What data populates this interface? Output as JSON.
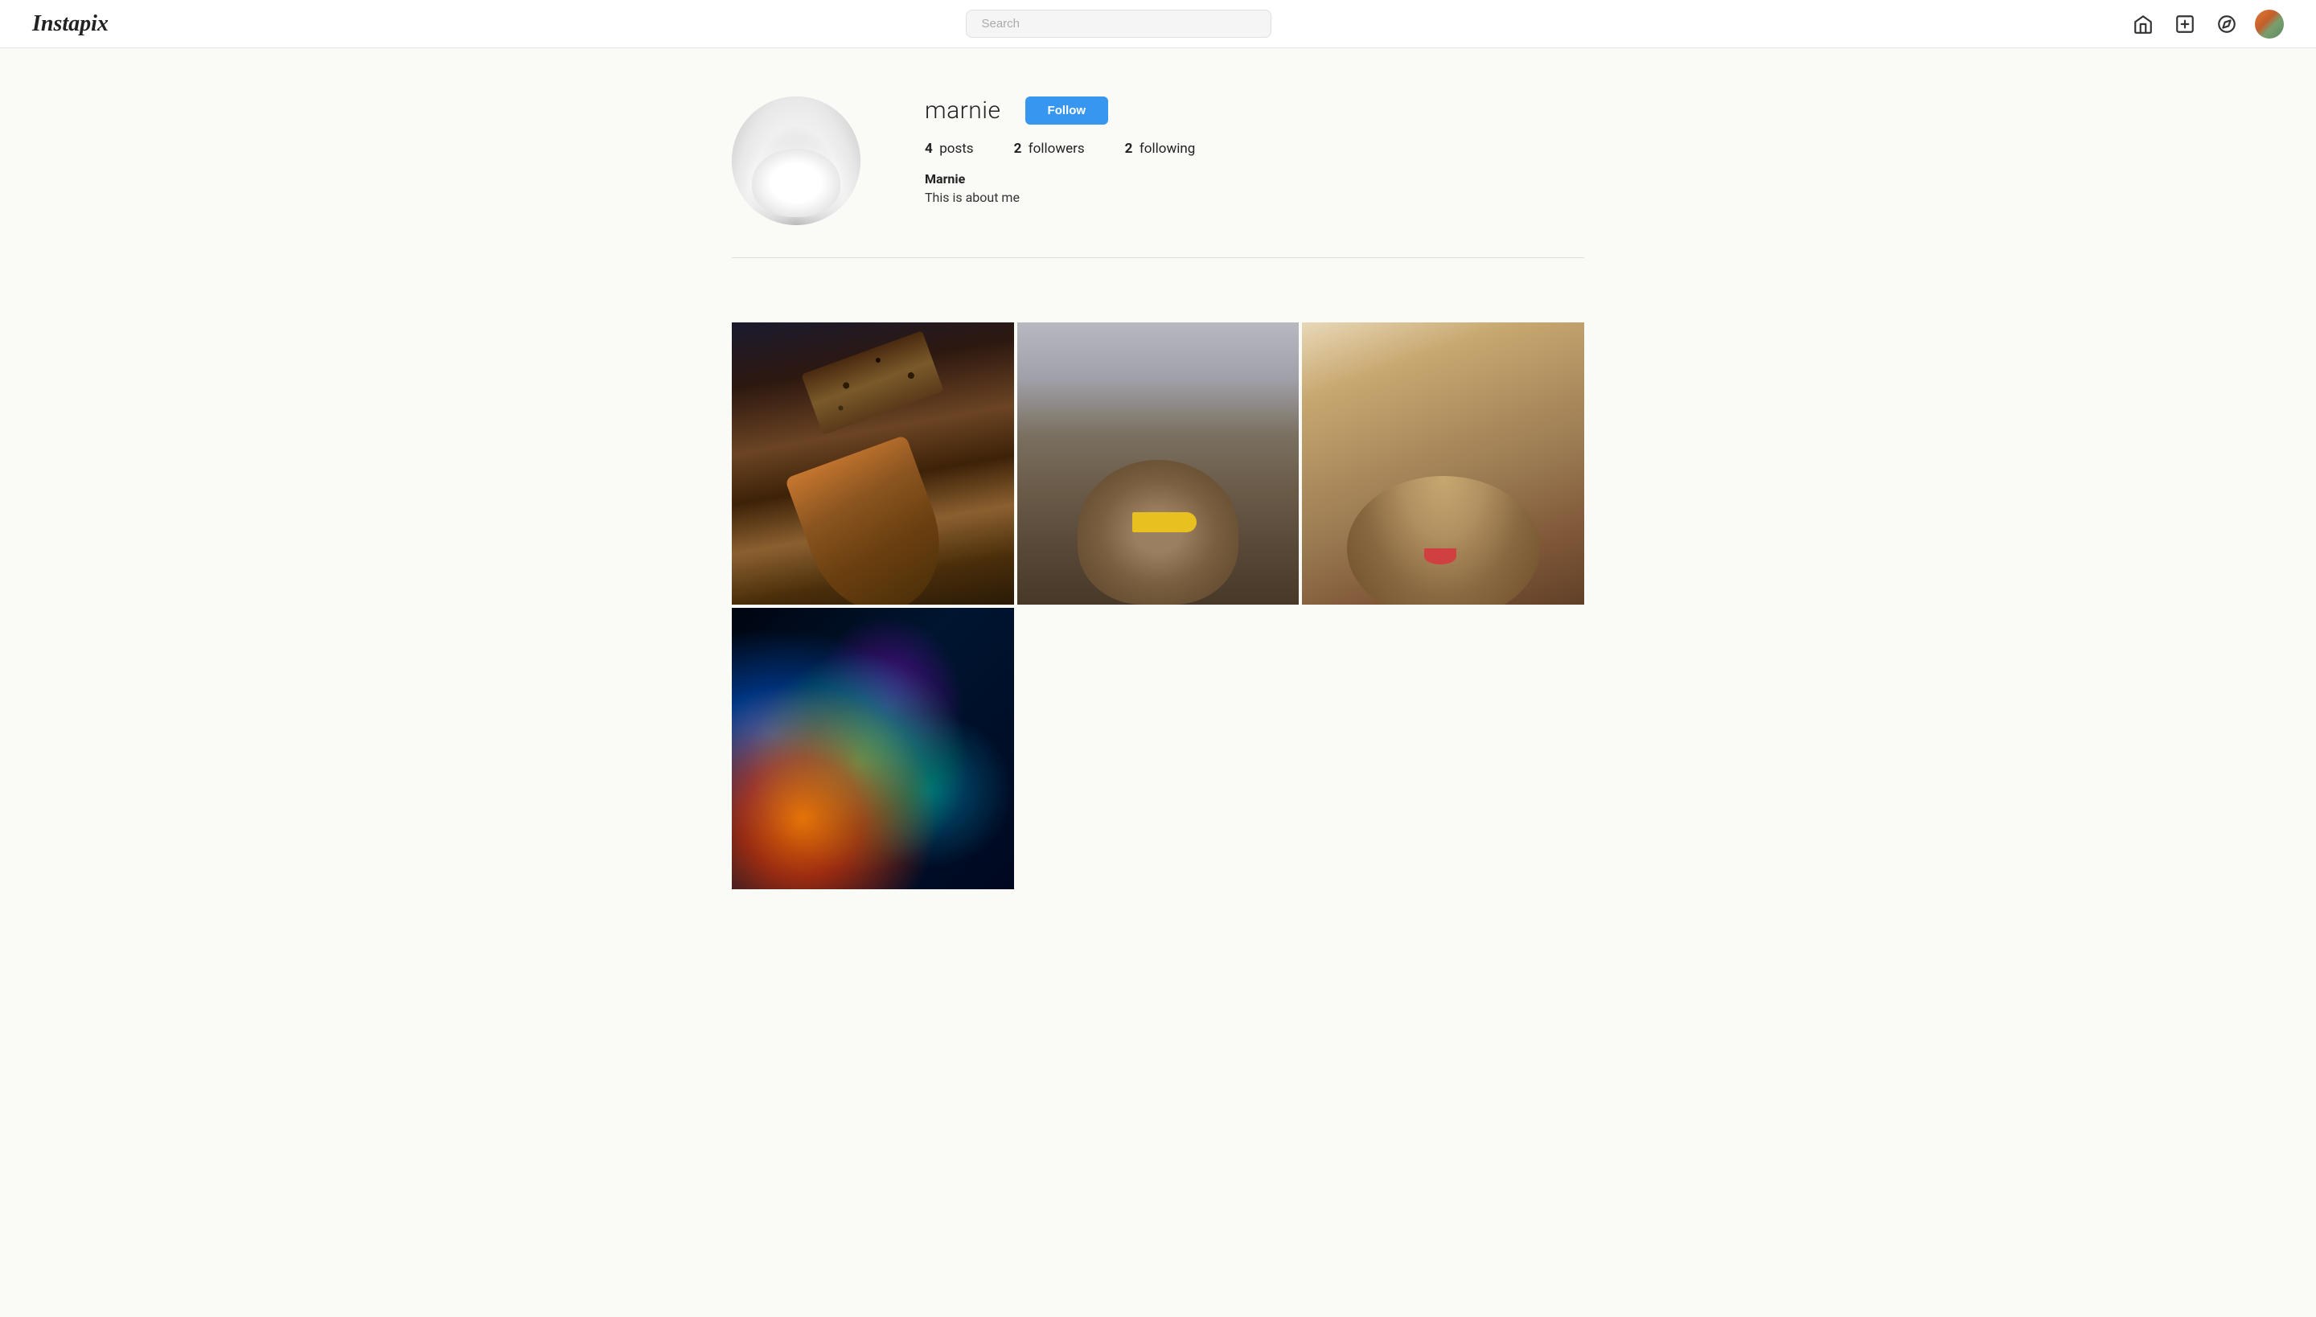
{
  "app": {
    "logo": "Instapix"
  },
  "navbar": {
    "search_placeholder": "Search",
    "search_value": "",
    "home_icon": "home-icon",
    "add_icon": "plus-icon",
    "compass_icon": "compass-icon",
    "avatar_icon": "user-avatar-icon"
  },
  "profile": {
    "username": "marnie",
    "display_name": "Marnie",
    "bio": "This is about me",
    "stats": {
      "posts_count": "4",
      "posts_label": "posts",
      "followers_count": "2",
      "followers_label": "followers",
      "following_count": "2",
      "following_label": "following"
    },
    "follow_button_label": "Follow"
  },
  "posts": {
    "items": [
      {
        "id": "post-1",
        "type": "waffle",
        "alt": "Waffle cone with chocolate toppings"
      },
      {
        "id": "post-2",
        "type": "dog",
        "alt": "Shaggy dog with duck bill"
      },
      {
        "id": "post-3",
        "type": "pug",
        "alt": "Pug sleeping with tongue out"
      },
      {
        "id": "post-4",
        "type": "lights",
        "alt": "Colorful light painting"
      }
    ]
  }
}
